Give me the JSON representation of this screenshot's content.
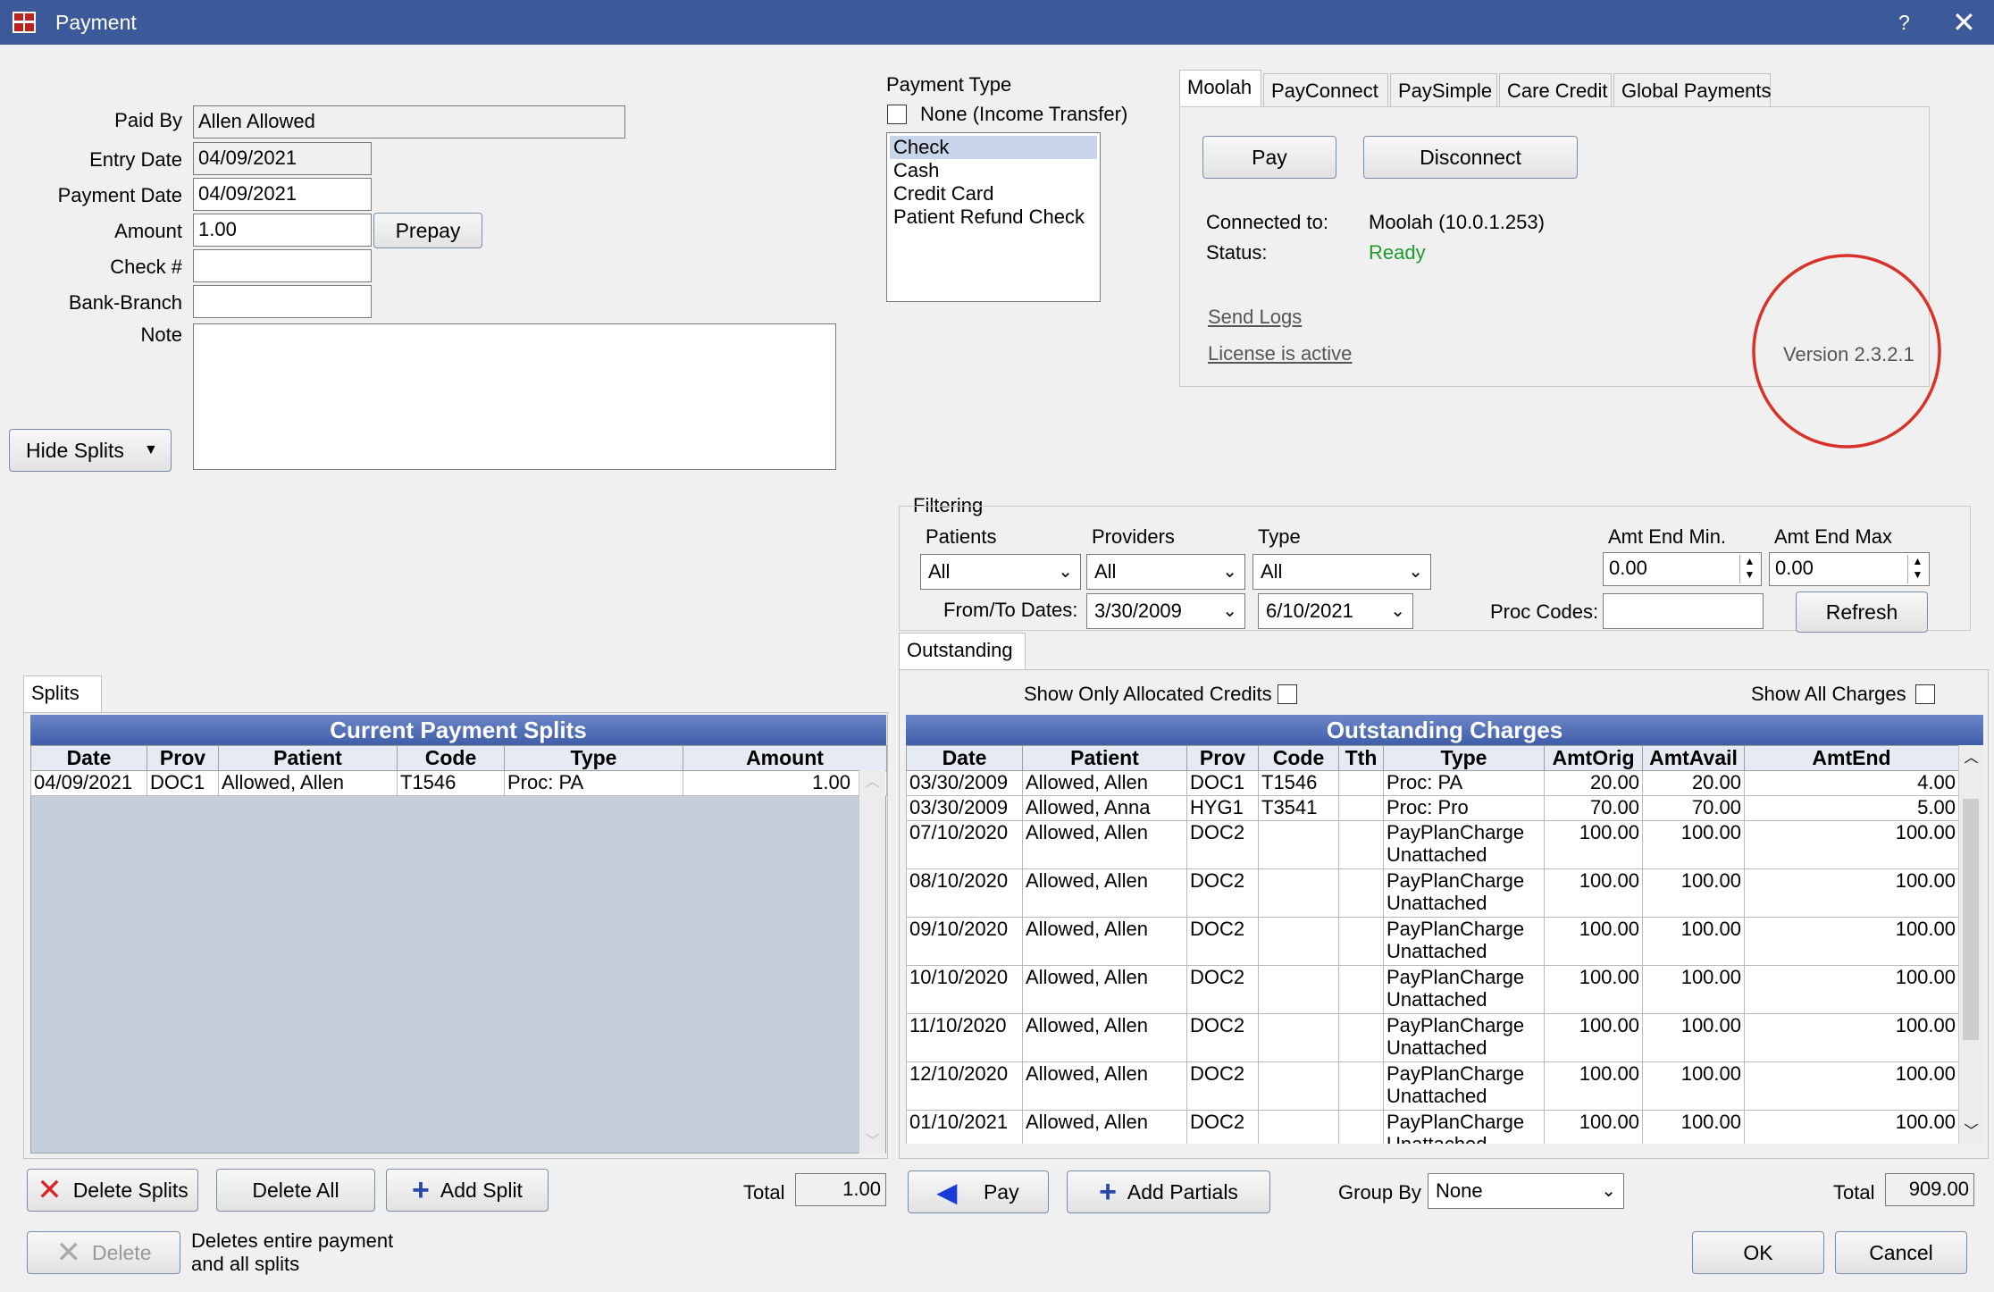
{
  "window": {
    "title": "Payment",
    "help": "?",
    "close": "✕"
  },
  "form": {
    "paid_by_label": "Paid By",
    "paid_by": "Allen Allowed",
    "entry_date_label": "Entry Date",
    "entry_date": "04/09/2021",
    "payment_date_label": "Payment Date",
    "payment_date": "04/09/2021",
    "amount_label": "Amount",
    "amount": "1.00",
    "prepay": "Prepay",
    "check_label": "Check #",
    "check": "",
    "bank_label": "Bank-Branch",
    "bank": "",
    "note_label": "Note",
    "note": "",
    "hide_splits": "Hide Splits"
  },
  "payment_type": {
    "label": "Payment Type",
    "none_label": "None (Income Transfer)",
    "options": [
      "Check",
      "Cash",
      "Credit Card",
      "Patient Refund Check"
    ],
    "selected": "Check"
  },
  "processor": {
    "tabs": [
      "Moolah",
      "PayConnect",
      "PaySimple",
      "Care Credit",
      "Global Payments"
    ],
    "active_tab": "Moolah",
    "pay": "Pay",
    "disconnect": "Disconnect",
    "connected_label": "Connected to:",
    "connected_value": "Moolah (10.0.1.253)",
    "status_label": "Status:",
    "status_value": "Ready",
    "status_color": "#1f9a2e",
    "send_logs": "Send Logs",
    "license": "License is active",
    "version": "Version 2.3.2.1",
    "highlight_color": "#d9312a"
  },
  "filtering": {
    "label": "Filtering",
    "patients_label": "Patients",
    "patients": "All",
    "providers_label": "Providers",
    "providers": "All",
    "type_label": "Type",
    "type": "All",
    "amt_min_label": "Amt End Min.",
    "amt_min": "0.00",
    "amt_max_label": "Amt End Max",
    "amt_max": "0.00",
    "dates_label": "From/To Dates:",
    "from": "3/30/2009",
    "to": "6/10/2021",
    "proc_codes_label": "Proc Codes:",
    "proc_codes": "",
    "refresh": "Refresh"
  },
  "splits": {
    "tab": "Splits",
    "title": "Current Payment Splits",
    "columns": [
      "Date",
      "Prov",
      "Patient",
      "Code",
      "Type",
      "Amount"
    ],
    "rows": [
      [
        "04/09/2021",
        "DOC1",
        "Allowed, Allen",
        "T1546",
        "Proc:  PA",
        "1.00"
      ]
    ],
    "delete_splits": "Delete Splits",
    "delete_all": "Delete All",
    "add_split": "Add Split",
    "total_label": "Total",
    "total": "1.00"
  },
  "outstanding": {
    "tab": "Outstanding",
    "show_allocated": "Show Only Allocated Credits",
    "show_all": "Show All Charges",
    "title": "Outstanding Charges",
    "columns": [
      "Date",
      "Patient",
      "Prov",
      "Code",
      "Tth",
      "Type",
      "AmtOrig",
      "AmtAvail",
      "AmtEnd"
    ],
    "rows": [
      [
        "03/30/2009",
        "Allowed, Allen",
        "DOC1",
        "T1546",
        "",
        "Proc:  PA",
        "",
        "20.00",
        "20.00",
        "4.00"
      ],
      [
        "03/30/2009",
        "Allowed, Anna",
        "HYG1",
        "T3541",
        "",
        "Proc:  Pro",
        "",
        "70.00",
        "70.00",
        "5.00"
      ],
      [
        "07/10/2020",
        "Allowed, Allen",
        "DOC2",
        "",
        "",
        "PayPlanCharge",
        "Unattached",
        "100.00",
        "100.00",
        "100.00"
      ],
      [
        "08/10/2020",
        "Allowed, Allen",
        "DOC2",
        "",
        "",
        "PayPlanCharge",
        "Unattached",
        "100.00",
        "100.00",
        "100.00"
      ],
      [
        "09/10/2020",
        "Allowed, Allen",
        "DOC2",
        "",
        "",
        "PayPlanCharge",
        "Unattached",
        "100.00",
        "100.00",
        "100.00"
      ],
      [
        "10/10/2020",
        "Allowed, Allen",
        "DOC2",
        "",
        "",
        "PayPlanCharge",
        "Unattached",
        "100.00",
        "100.00",
        "100.00"
      ],
      [
        "11/10/2020",
        "Allowed, Allen",
        "DOC2",
        "",
        "",
        "PayPlanCharge",
        "Unattached",
        "100.00",
        "100.00",
        "100.00"
      ],
      [
        "12/10/2020",
        "Allowed, Allen",
        "DOC2",
        "",
        "",
        "PayPlanCharge",
        "Unattached",
        "100.00",
        "100.00",
        "100.00"
      ],
      [
        "01/10/2021",
        "Allowed, Allen",
        "DOC2",
        "",
        "",
        "PayPlanCharge",
        "Unattached",
        "100.00",
        "100.00",
        "100.00"
      ]
    ],
    "pay": "Pay",
    "add_partials": "Add Partials",
    "group_by_label": "Group By",
    "group_by": "None",
    "total_label": "Total",
    "total": "909.00"
  },
  "footer": {
    "delete": "Delete",
    "delete_note_1": "Deletes entire payment",
    "delete_note_2": "and all splits",
    "ok": "OK",
    "cancel": "Cancel"
  }
}
